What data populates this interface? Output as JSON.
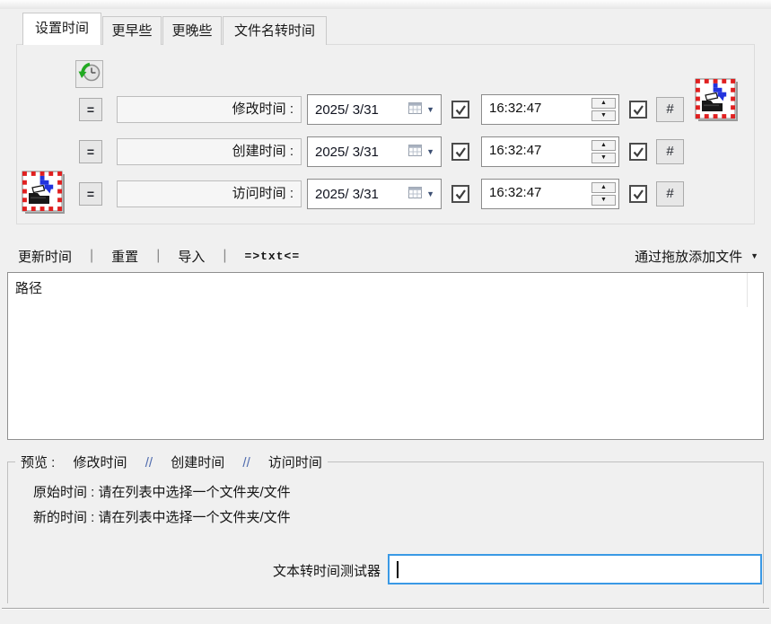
{
  "tabs": {
    "items": [
      "设置时间",
      "更早些",
      "更晚些",
      "文件名转时间"
    ]
  },
  "rows": [
    {
      "label": "修改时间 :",
      "date": "2025/ 3/31",
      "time": "16:32:47"
    },
    {
      "label": "创建时间 :",
      "date": "2025/ 3/31",
      "time": "16:32:47"
    },
    {
      "label": "访问时间 :",
      "date": "2025/ 3/31",
      "time": "16:32:47"
    }
  ],
  "symbols": {
    "equals": "=",
    "hash": "#",
    "spinner_up": "▲",
    "spinner_down": "▼",
    "dropdown_arrow": "▼"
  },
  "toolbar": {
    "update": "更新时间",
    "reset": "重置",
    "import": "导入",
    "txt": "=>txt<=",
    "separator": "|",
    "add_files": "通过拖放添加文件",
    "add_files_arrow": "▼"
  },
  "list": {
    "path_header": "路径"
  },
  "preview": {
    "title": "预览 :",
    "modified": "修改时间",
    "created": "创建时间",
    "accessed": "访问时间",
    "separator": "//",
    "original_line": "原始时间 : 请在列表中选择一个文件夹/文件",
    "new_line": "新的时间 : 请在列表中选择一个文件夹/文件"
  },
  "tester": {
    "label": "文本转时间测试器",
    "value": ""
  },
  "icons": {
    "app_icon": "folder-time-app-icon",
    "history_icon": "history-clock-icon",
    "calendar_icon": "calendar-icon"
  },
  "colors": {
    "focus_accent": "#3a99e5",
    "icon_red": "#e02020",
    "icon_blue": "#2233dd",
    "arrow_green": "#22aa22",
    "background": "#f0f0f0"
  }
}
